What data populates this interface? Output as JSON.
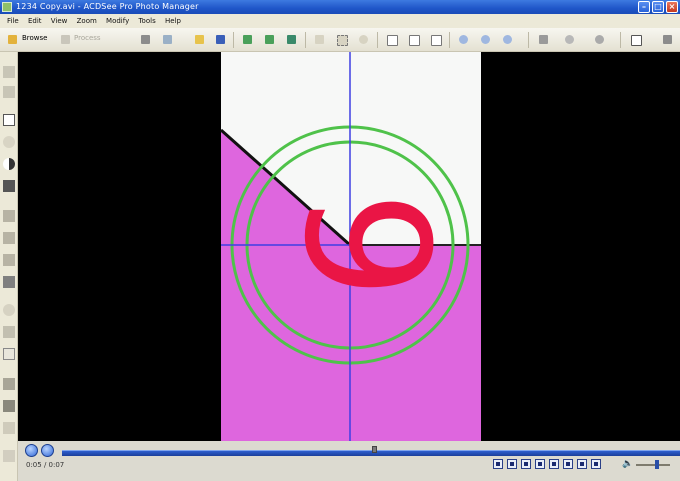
{
  "window": {
    "title": "1234 Copy.avi - ACDSee Pro Photo Manager"
  },
  "menu": [
    "File",
    "Edit",
    "View",
    "Zoom",
    "Modify",
    "Tools",
    "Help"
  ],
  "toolbar": {
    "browse_label": "Browse",
    "process_label": "Process"
  },
  "playback": {
    "time_display": "0:05 / 0:07"
  },
  "frame": {
    "digit": "6"
  },
  "colors": {
    "accent": "#1f56c8",
    "frame_top": "#f7f8f7",
    "frame_bottom": "#de66de",
    "digit": "#ea1545",
    "circles": "#4fc24a",
    "crosshair": "#3f3fe3"
  }
}
